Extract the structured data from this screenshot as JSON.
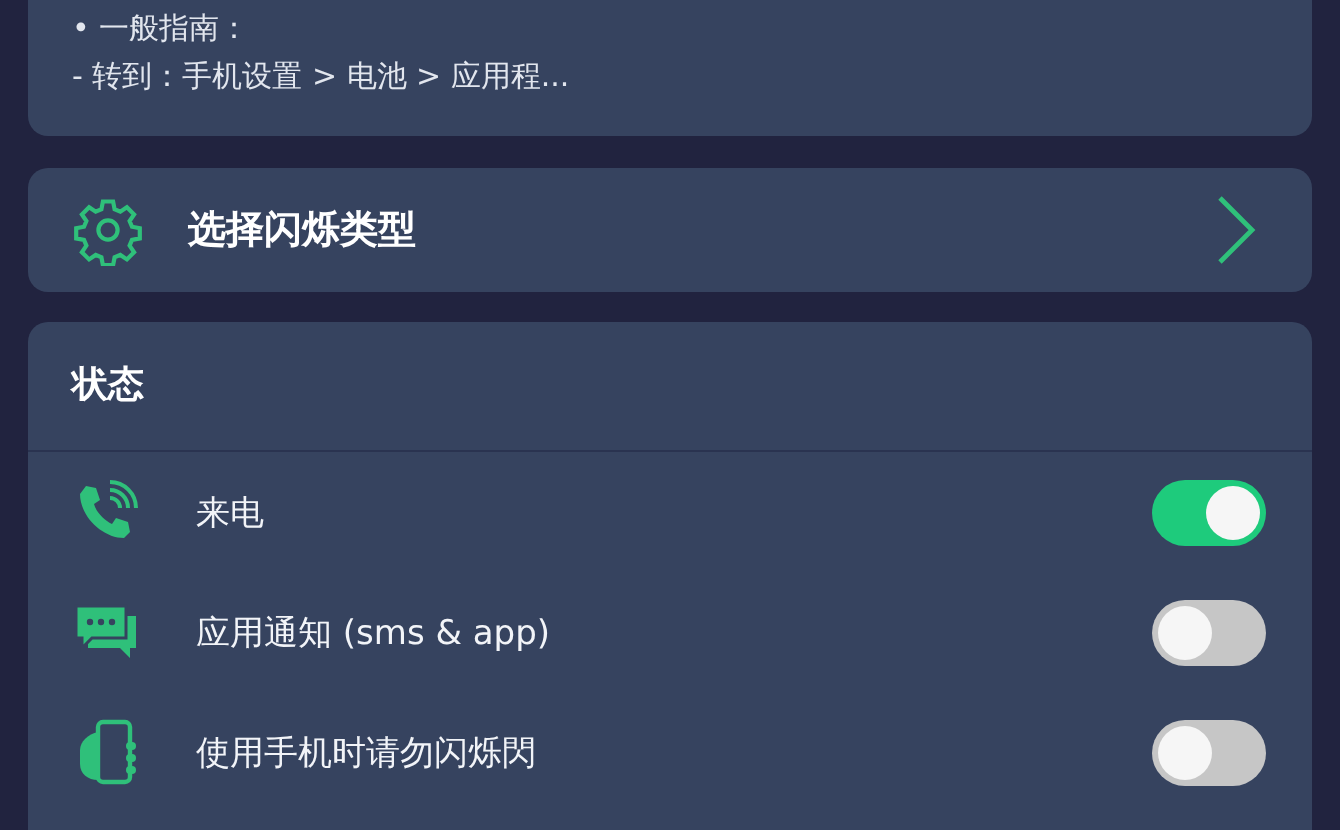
{
  "guide": {
    "lines": [
      "• 一般指南：",
      "- 转到：手机设置 > 电池 > 应用程..."
    ]
  },
  "flash_type": {
    "label": "选择闪烁类型"
  },
  "status": {
    "title": "状态",
    "rows": [
      {
        "kind": "call",
        "label": "来电",
        "on": true
      },
      {
        "kind": "message",
        "label": "应用通知 (sms & app)",
        "on": false
      },
      {
        "kind": "hand",
        "label": "使用手机时请勿闪烁閃",
        "on": false
      }
    ]
  }
}
